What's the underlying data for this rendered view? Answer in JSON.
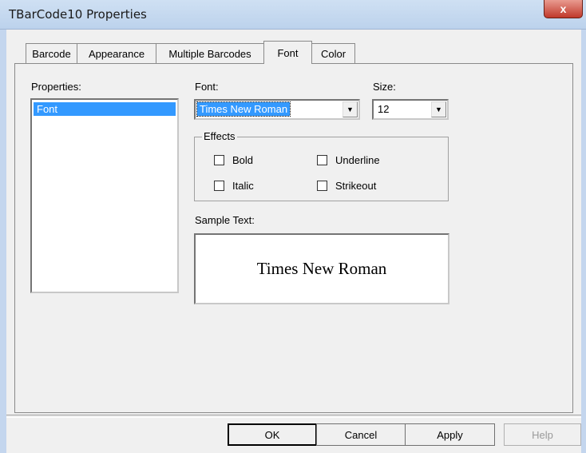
{
  "window": {
    "title": "TBarCode10 Properties",
    "close_glyph": "x"
  },
  "tabs": [
    {
      "label": "Barcode"
    },
    {
      "label": "Appearance"
    },
    {
      "label": "Multiple Barcodes"
    },
    {
      "label": "Font",
      "active": true
    },
    {
      "label": "Color"
    }
  ],
  "properties": {
    "label": "Properties:",
    "items": [
      "Font"
    ]
  },
  "font": {
    "label": "Font:",
    "value": "Times New Roman"
  },
  "size": {
    "label": "Size:",
    "value": "12"
  },
  "effects": {
    "label": "Effects",
    "bold": {
      "label": "Bold",
      "checked": false
    },
    "underline": {
      "label": "Underline",
      "checked": false
    },
    "italic": {
      "label": "Italic",
      "checked": false
    },
    "strikeout": {
      "label": "Strikeout",
      "checked": false
    }
  },
  "sample": {
    "label": "Sample Text:",
    "text": "Times New Roman"
  },
  "buttons": {
    "ok": "OK",
    "cancel": "Cancel",
    "apply": "Apply",
    "help": "Help"
  }
}
